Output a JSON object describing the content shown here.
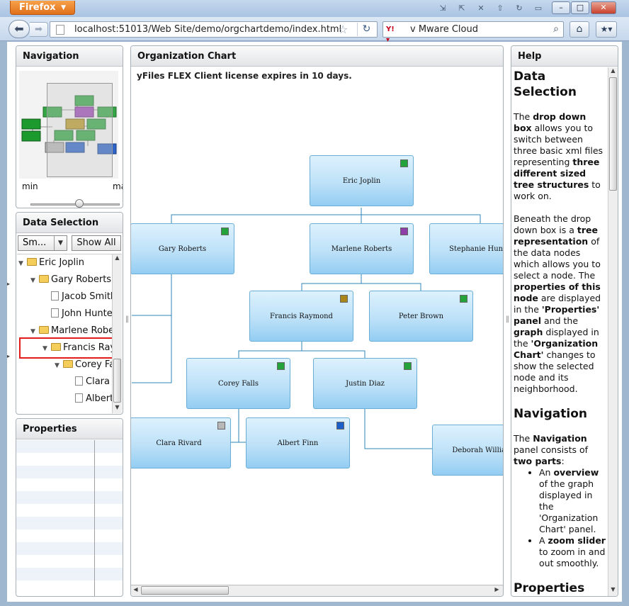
{
  "browser": {
    "app_button": "Firefox",
    "url": "localhost:51013/Web Site/demo/orgchartdemo/index.html",
    "search_engine_label": "Y!",
    "search_text": "v Mware Cloud"
  },
  "panels": {
    "navigation_title": "Navigation",
    "data_selection_title": "Data Selection",
    "properties_title": "Properties",
    "org_chart_title": "Organization Chart",
    "help_title": "Help"
  },
  "navigation": {
    "zoom_min_label": "min",
    "zoom_max_label": "max",
    "zoom_level": 0.55
  },
  "data_selection": {
    "combo_value": "Sm...",
    "show_all_label": "Show All",
    "tree": [
      {
        "label": "Eric Joplin",
        "type": "folder",
        "depth": 0,
        "expanded": true
      },
      {
        "label": "Gary Roberts",
        "type": "folder",
        "depth": 1,
        "expanded": true
      },
      {
        "label": "Jacob Smith",
        "type": "file",
        "depth": 2
      },
      {
        "label": "John Hunter",
        "type": "file",
        "depth": 2
      },
      {
        "label": "Marlene Roberts",
        "type": "folder",
        "depth": 1,
        "expanded": true
      },
      {
        "label": "Francis Raymond",
        "type": "folder",
        "depth": 2,
        "expanded": true,
        "selected": true
      },
      {
        "label": "Corey Falls",
        "type": "folder",
        "depth": 3,
        "expanded": true
      },
      {
        "label": "Clara Rivard",
        "type": "file",
        "depth": 4
      },
      {
        "label": "Albert Finn",
        "type": "file",
        "depth": 4
      }
    ]
  },
  "org_chart": {
    "license_notice": "yFiles FLEX Client license expires in 10 days.",
    "nodes": [
      {
        "name": "Eric Joplin",
        "badge": "#23a33a"
      },
      {
        "name": "Gary Roberts",
        "badge": "#23a33a"
      },
      {
        "name": "Marlene Roberts",
        "badge": "#8e3ea6"
      },
      {
        "name": "Stephanie Hunter",
        "badge": ""
      },
      {
        "name": "Francis Raymond",
        "badge": "#a8861a"
      },
      {
        "name": "Peter Brown",
        "badge": "#23a33a"
      },
      {
        "name": "Corey Falls",
        "badge": "#23a33a"
      },
      {
        "name": "Justin Diaz",
        "badge": "#23a33a"
      },
      {
        "name": "Clara Rivard",
        "badge": "#b8b8b8"
      },
      {
        "name": "Albert Finn",
        "badge": "#1c5fc8"
      },
      {
        "name": "Deborah Williams",
        "badge": ""
      }
    ]
  },
  "help": {
    "h_data_selection": "Data Selection",
    "p1": {
      "a": "The ",
      "b": "drop down box",
      "c": " allows you to switch between three basic xml files representing ",
      "d": "three different sized tree structures",
      "e": " to work on."
    },
    "p2": {
      "a": "Beneath the drop down box is a ",
      "b": "tree representation",
      "c": " of the data nodes which allows you to select a node. The ",
      "d": "properties of this node",
      "e": " are displayed in the ",
      "f": "'Properties' panel",
      "g": " and the ",
      "h": "graph",
      "i": " displayed in the ",
      "j": "'Organization Chart'",
      "k": " changes to show the selected node and its neighborhood."
    },
    "h_navigation": "Navigation",
    "p3": {
      "a": "The ",
      "b": "Navigation",
      "c": " panel consists of ",
      "d": "two parts",
      "e": ":"
    },
    "li1": {
      "a": "An ",
      "b": "overview",
      "c": " of the graph displayed in the 'Organization Chart' panel."
    },
    "li2": {
      "a": "A ",
      "b": "zoom slider",
      "c": " to zoom in and out smoothly."
    },
    "h_properties": "Properties"
  },
  "colors": {
    "node_green": "#23a33a",
    "node_purple": "#8e3ea6",
    "node_olive": "#a8861a",
    "node_blue": "#1c5fc8",
    "node_gray": "#b8b8b8",
    "selection_red": "#e21b1b"
  }
}
